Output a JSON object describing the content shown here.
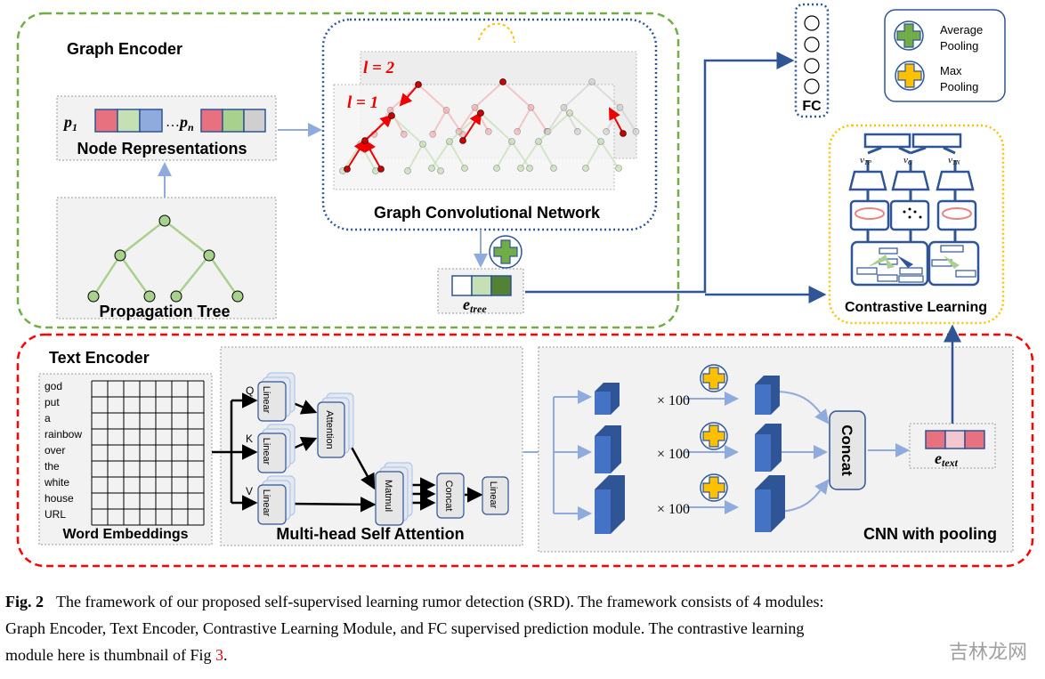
{
  "graph_encoder": {
    "title": "Graph Encoder",
    "node_repr_label": "Node Representations",
    "p1": "p",
    "p1_sub": "1",
    "pn": "p",
    "pn_sub": "n",
    "ellipsis": "…",
    "propagation_tree_label": "Propagation Tree",
    "gcn_label": "Graph Convolutional Network",
    "layer2": "l = 2",
    "layer1": "l = 1",
    "e_tree": "e",
    "e_tree_sub": "tree"
  },
  "fc": {
    "label": "FC"
  },
  "legend": {
    "average_pooling": "Average Pooling",
    "average_line1": "Average",
    "average_line2": "Pooling",
    "max_line1": "Max",
    "max_line2": "Pooling",
    "average_color": "#70ad47",
    "max_color": "#ffc000"
  },
  "contrastive": {
    "label": "Contrastive Learning",
    "v1": "v",
    "v1_sub": "TP",
    "v2": "v",
    "v2_sub": "G",
    "v3": "v",
    "v3_sub": "TN"
  },
  "text_encoder": {
    "title": "Text Encoder",
    "words": [
      "god",
      "put",
      "a",
      "rainbow",
      "over",
      "the",
      "white",
      "house",
      "URL"
    ],
    "word_embeddings_label": "Word Embeddings",
    "mhsa_label": "Multi-head Self Attention",
    "q": "Q",
    "k": "K",
    "v": "V",
    "linear": "Linear",
    "attention": "Attention",
    "matmul": "Matmul",
    "concat": "Concat",
    "cnn_label": "CNN with pooling",
    "times": "× 100",
    "cnn_concat": "Concat",
    "e_text": "e",
    "e_text_sub": "text"
  },
  "caption": {
    "fig": "Fig. 2",
    "line1": "The framework of our proposed self-supervised learning rumor detection (SRD). The framework consists of 4 modules:",
    "line2": "Graph Encoder, Text Encoder, Contrastive Learning Module, and FC supervised prediction module. The contrastive learning",
    "line3": "module here is thumbnail of Fig ",
    "ref": "3",
    "line3_end": "."
  },
  "watermark": "吉林龙网",
  "colors": {
    "green_dash": "#70ad47",
    "red_dash": "#ff0000",
    "blue": "#2f5597",
    "yellow": "#ffc000",
    "arrow_light": "#8faadc"
  }
}
